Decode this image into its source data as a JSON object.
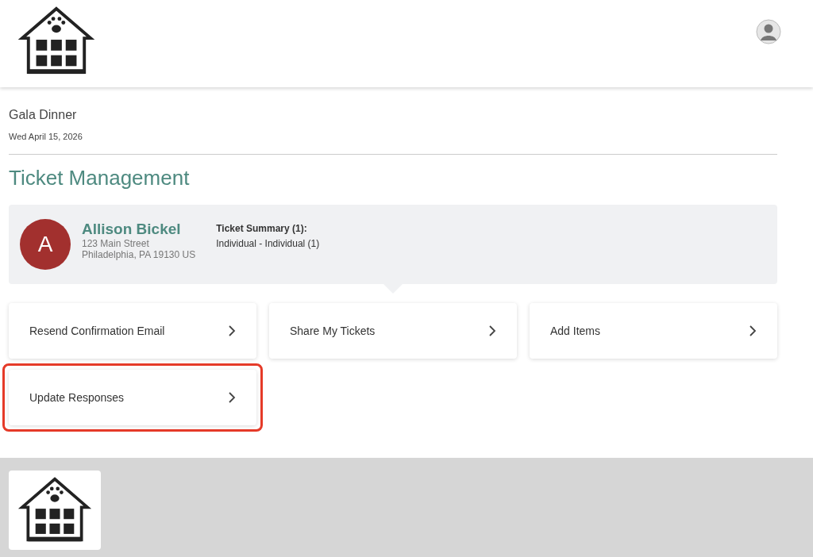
{
  "event": {
    "name": "Gala Dinner",
    "date": "Wed April 15, 2026"
  },
  "title": "Ticket Management",
  "attendee": {
    "initial": "A",
    "name": "Allison Bickel",
    "address_line_1": "123 Main Street",
    "address_line_2": "Philadelphia, PA 19130 US"
  },
  "summary": {
    "heading": "Ticket Summary (1):",
    "lines": [
      "Individual - Individual (1)"
    ]
  },
  "actions": [
    {
      "label": "Resend Confirmation Email",
      "highlighted": false
    },
    {
      "label": "Share My Tickets",
      "highlighted": false
    },
    {
      "label": "Add Items",
      "highlighted": false
    },
    {
      "label": "Update Responses",
      "highlighted": true
    }
  ]
}
